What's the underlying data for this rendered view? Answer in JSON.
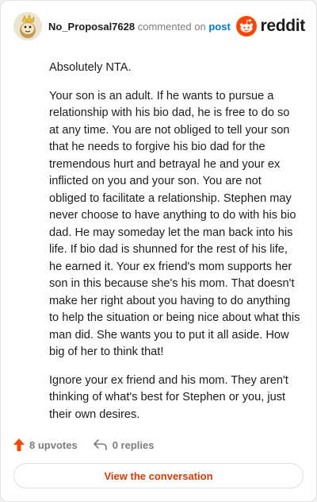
{
  "comment": {
    "username": "No_Proposal7628",
    "action": "commented on",
    "target": "post",
    "paragraphs": [
      "Absolutely NTA.",
      "Your son is an adult. If he wants to pursue a relationship with his bio dad, he is free to do so at any time. You are not obliged to tell your son that he needs to forgive his bio dad for the tremendous hurt and betrayal he and your ex inflicted on you and your son. You are not obliged to facilitate a relationship. Stephen may never choose to have anything to do with his bio dad. He may someday let the man back into his life. If bio dad is shunned for the rest of his life, he earned it. Your ex friend's mom supports her son in this because she's his mom. That doesn't make her right about you having to do anything to help the situation or being nice about what this man did. She wants you to put it all aside. How big of her to think that!",
      "Ignore your ex friend and his mom. They aren't thinking of what's best for Stephen or you, just their own desires."
    ]
  },
  "brand": {
    "name": "reddit",
    "color": "#ff4500",
    "icon": "reddit-alien-icon"
  },
  "footer": {
    "upvotes": "8 upvotes",
    "replies": "0 replies",
    "upvote_icon": "upvote-arrow-icon",
    "reply_icon": "reply-arrow-icon",
    "upvote_color": "#ff4500"
  },
  "cta": {
    "label": "View the conversation",
    "color": "#d93a00"
  },
  "avatar": {
    "icon": "snoo-avatar-icon"
  }
}
